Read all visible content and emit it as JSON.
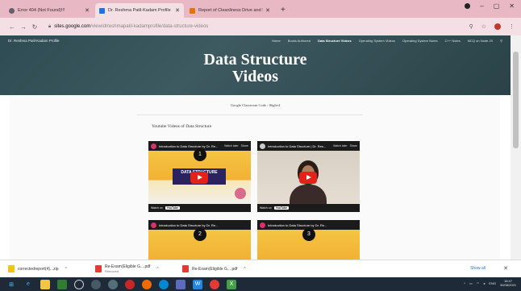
{
  "browser": {
    "tabs": [
      {
        "title": "Error 404 (Not Found)!!!",
        "favicon_color": "#5f6368",
        "active": false
      },
      {
        "title": "Dr. Reshma Patil-Kadam Profile",
        "favicon_color": "#1a73e8",
        "active": true
      },
      {
        "title": "Report of Cleanliness Drive and Sa",
        "favicon_color": "#e8710a",
        "active": false
      }
    ],
    "new_tab_label": "+",
    "url_host": "sites.google.com",
    "url_path": "/view/drreshmapatil-kadamprofile/data-structure-videos"
  },
  "site": {
    "name": "Dr. Reshma Patil-Kadam Profile",
    "nav": [
      "Home",
      "Books Authored",
      "Data Structure Videos",
      "Operating System Videos",
      "Operating System Notes",
      "C++ Notes",
      "MCQ on Node.JS"
    ],
    "current_nav": "Data Structure Videos",
    "banner_title_line1": "Data Structure",
    "banner_title_line2": "Videos",
    "google_classroom": "Google Classroom Code : l6ighv4",
    "section_title": "Youtube Videos of Data Structure",
    "videos": [
      {
        "title": "Introduction to Data Structure by Dr. Re...",
        "number": "1",
        "thumb_text": "DATA STRUCTURE",
        "watch_on": "Watch on",
        "youtube": "YouTube",
        "watch_later": "Watch later",
        "share": "Share"
      },
      {
        "title": "Introduction to Data Structure | Dr. Res...",
        "number": "",
        "thumb_text": "",
        "watch_on": "Watch on",
        "youtube": "YouTube",
        "watch_later": "Watch later",
        "share": "Share"
      },
      {
        "title": "Introduction to Data Structure by Dr. Re...",
        "number": "2",
        "thumb_text": "",
        "watch_on": "",
        "youtube": "",
        "watch_later": "",
        "share": ""
      },
      {
        "title": "Introduction to Data Structure by Dr. Re...",
        "number": "3",
        "thumb_text": "",
        "watch_on": "",
        "youtube": "",
        "watch_later": "",
        "share": ""
      }
    ]
  },
  "downloads": {
    "items": [
      {
        "name": "correctedreport(4)...zip",
        "status": "",
        "icon_color": "#f1c40f"
      },
      {
        "name": "Re-Exam(Eligible G....pdf",
        "status": "Removed",
        "icon_color": "#e53935"
      },
      {
        "name": "Re-Exam(Eligible G....pdf",
        "status": "",
        "icon_color": "#e53935"
      }
    ],
    "show_all": "Show all"
  },
  "taskbar": {
    "lang": "ENG",
    "time": "16:47",
    "date": "30/08/2021"
  }
}
